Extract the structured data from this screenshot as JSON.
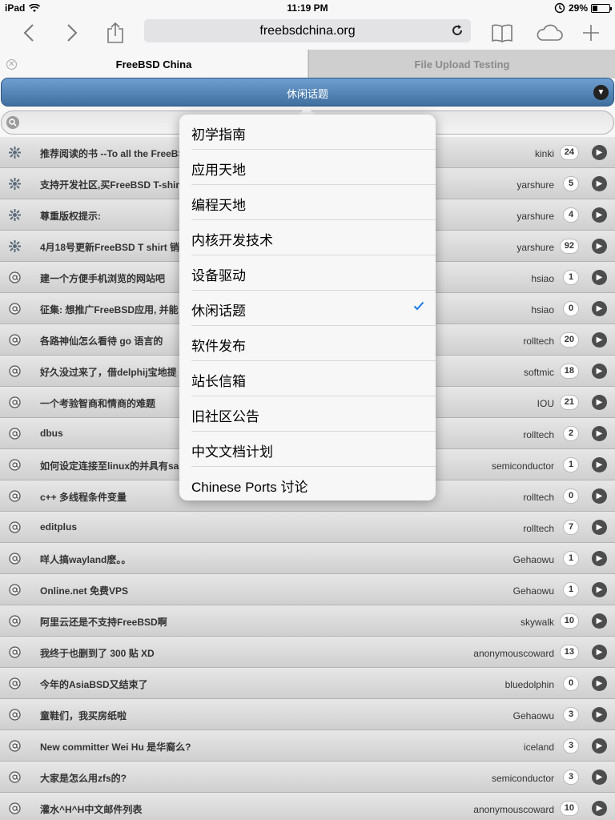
{
  "status": {
    "device": "iPad",
    "time": "11:19 PM",
    "battery": "29%"
  },
  "browser": {
    "url": "freebsdchina.org"
  },
  "tabs": [
    {
      "label": "FreeBSD China"
    },
    {
      "label": "File Upload Testing"
    }
  ],
  "category": {
    "current": "休闲话题"
  },
  "search": {
    "placeholder": ""
  },
  "dropdown": {
    "items": [
      {
        "label": "初学指南"
      },
      {
        "label": "应用天地"
      },
      {
        "label": "编程天地"
      },
      {
        "label": "内核开发技术"
      },
      {
        "label": "设备驱动"
      },
      {
        "label": "休闲话题",
        "selected": true
      },
      {
        "label": "软件发布"
      },
      {
        "label": "站长信箱"
      },
      {
        "label": "旧社区公告"
      },
      {
        "label": "中文文档计划"
      },
      {
        "label": "Chinese Ports 讨论"
      }
    ]
  },
  "topics": [
    {
      "title": "推荐阅读的书 --To all the FreeBS",
      "author": "kinki",
      "replies": "24",
      "icon": "pinned-icon"
    },
    {
      "title": "支持开发社区,买FreeBSD T-shir",
      "author": "yarshure",
      "replies": "5",
      "icon": "pinned-icon"
    },
    {
      "title": "尊重版权提示:",
      "author": "yarshure",
      "replies": "4",
      "icon": "pinned-icon"
    },
    {
      "title": "4月18号更新FreeBSD T shirt 销",
      "author": "yarshure",
      "replies": "92",
      "icon": "pinned-icon"
    },
    {
      "title": "建一个方便手机浏览的网站吧",
      "author": "hsiao",
      "replies": "1",
      "icon": "topic-icon"
    },
    {
      "title": "征集: 想推广FreeBSD应用, 并能",
      "author": "hsiao",
      "replies": "0",
      "icon": "topic-icon"
    },
    {
      "title": "各路神仙怎么看待 go 语言的",
      "author": "rolltech",
      "replies": "20",
      "icon": "topic-icon"
    },
    {
      "title": "好久没过来了，借delphij宝地提",
      "author": "softmic",
      "replies": "18",
      "icon": "topic-icon"
    },
    {
      "title": "一个考验智商和情商的难题",
      "author": "IOU",
      "replies": "21",
      "icon": "topic-icon"
    },
    {
      "title": "dbus",
      "author": "rolltech",
      "replies": "2",
      "icon": "topic-icon"
    },
    {
      "title": "如何设定连接至linux的并具有sa",
      "author": "semiconductor",
      "replies": "1",
      "icon": "topic-icon"
    },
    {
      "title": "c++ 多线程条件变量",
      "author": "rolltech",
      "replies": "0",
      "icon": "topic-icon"
    },
    {
      "title": "editplus",
      "author": "rolltech",
      "replies": "7",
      "icon": "topic-icon"
    },
    {
      "title": "咩人搞wayland麽。。",
      "author": "Gehaowu",
      "replies": "1",
      "icon": "topic-icon"
    },
    {
      "title": "Online.net 免费VPS",
      "author": "Gehaowu",
      "replies": "1",
      "icon": "topic-icon"
    },
    {
      "title": "阿里云还是不支持FreeBSD啊",
      "author": "skywalk",
      "replies": "10",
      "icon": "topic-icon"
    },
    {
      "title": "我终于也删到了 300 贴 XD",
      "author": "anonymouscoward",
      "replies": "13",
      "icon": "topic-icon"
    },
    {
      "title": "今年的AsiaBSD又结束了",
      "author": "bluedolphin",
      "replies": "0",
      "icon": "topic-icon"
    },
    {
      "title": "童鞋们，我买房纸啦",
      "author": "Gehaowu",
      "replies": "3",
      "icon": "topic-icon"
    },
    {
      "title": "New committer Wei Hu 是华裔么?",
      "author": "iceland",
      "replies": "3",
      "icon": "topic-icon"
    },
    {
      "title": "大家是怎么用zfs的?",
      "author": "semiconductor",
      "replies": "3",
      "icon": "topic-icon"
    },
    {
      "title": "灌水^H^H中文邮件列表",
      "author": "anonymouscoward",
      "replies": "10",
      "icon": "topic-icon"
    }
  ]
}
